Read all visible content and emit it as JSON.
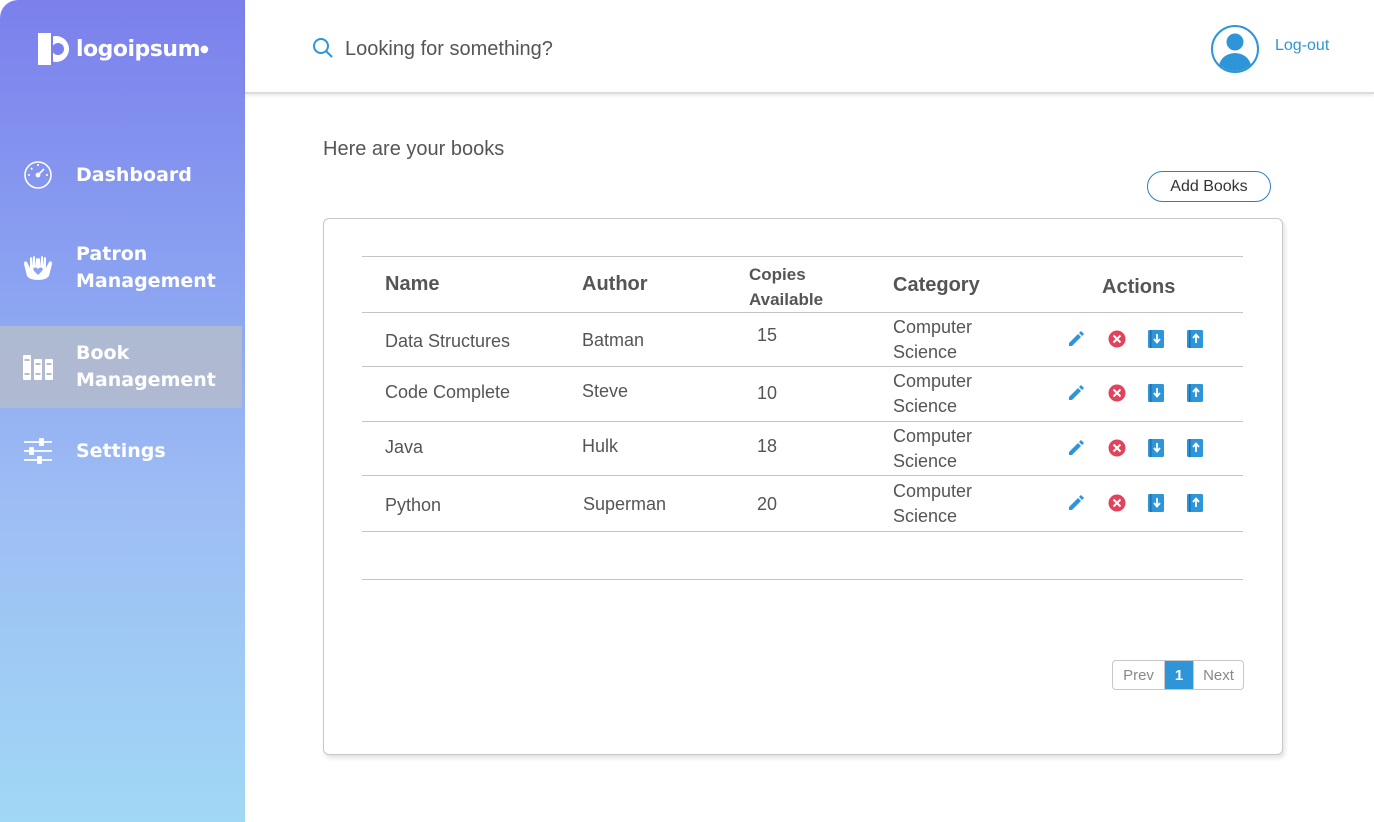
{
  "logo": {
    "text": "logoipsum"
  },
  "sidebar": {
    "items": [
      {
        "label": "Dashboard",
        "icon": "speedometer-icon"
      },
      {
        "label_line1": "Patron",
        "label_line2": "Management",
        "icon": "hands-heart-icon"
      },
      {
        "label_line1": "Book",
        "label_line2": "Management",
        "icon": "books-icon",
        "active": true
      },
      {
        "label": "Settings",
        "icon": "sliders-icon"
      }
    ]
  },
  "header": {
    "search_placeholder": "Looking for something?",
    "logout_label": "Log-out"
  },
  "main": {
    "title": "Here are your books",
    "add_button": "Add Books",
    "table": {
      "columns": [
        "Name",
        "Author",
        "Copies",
        "Available",
        "Category",
        "Actions"
      ],
      "rows": [
        {
          "name": "Data Structures",
          "author": "Batman",
          "copies": "15",
          "cat1": "Computer",
          "cat2": "Science"
        },
        {
          "name": "Code Complete",
          "author": "Steve",
          "copies": "10",
          "cat1": "Computer",
          "cat2": "Science"
        },
        {
          "name": "Java",
          "author": "Hulk",
          "copies": "18",
          "cat1": "Computer",
          "cat2": "Science"
        },
        {
          "name": "Python",
          "author": "Superman",
          "copies": "20",
          "cat1": "Computer",
          "cat2": "Science"
        }
      ]
    },
    "pagination": {
      "prev": "Prev",
      "current": "1",
      "next": "Next"
    }
  },
  "colors": {
    "accent": "#2d95d8",
    "delete": "#e0435b",
    "sidebar_top": "#7b80ec",
    "sidebar_bottom": "#a1d8f5"
  }
}
